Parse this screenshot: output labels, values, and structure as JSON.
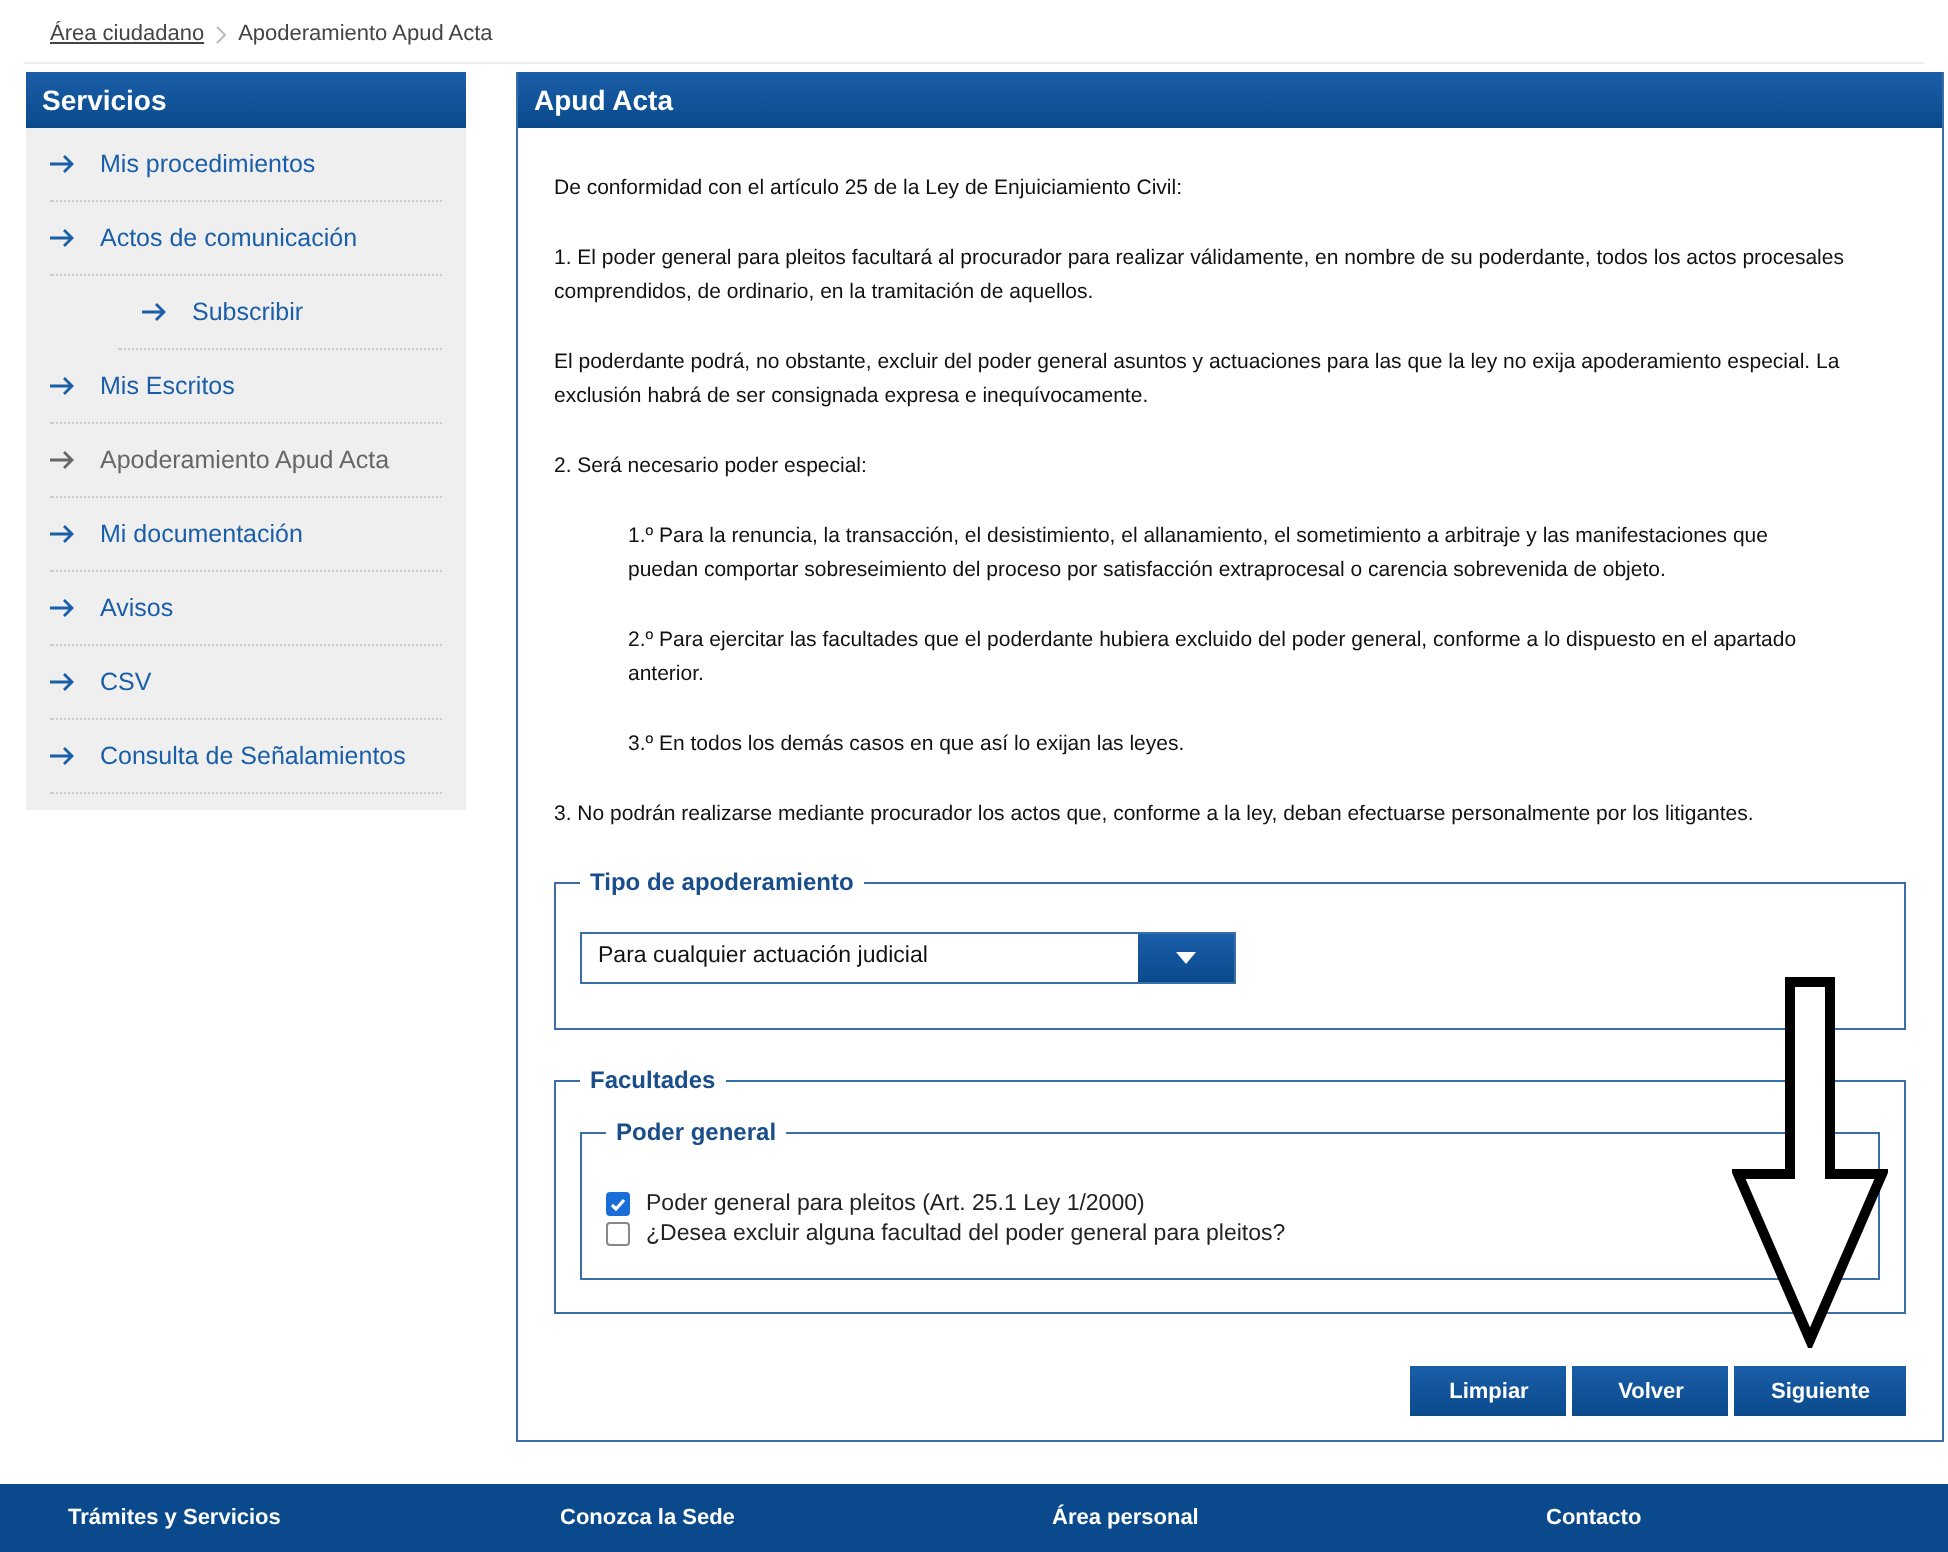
{
  "breadcrumb": [
    {
      "label": "Área ciudadano",
      "link": true
    },
    {
      "label": "Apoderamiento Apud Acta",
      "link": false
    }
  ],
  "sidebar": {
    "title": "Servicios",
    "items": [
      {
        "label": "Mis procedimientos",
        "selected": false
      },
      {
        "label": "Actos de comunicación",
        "selected": false,
        "children": [
          {
            "label": "Subscribir",
            "selected": false
          }
        ]
      },
      {
        "label": "Mis Escritos",
        "selected": false
      },
      {
        "label": "Apoderamiento Apud Acta",
        "selected": true
      },
      {
        "label": "Mi documentación",
        "selected": false
      },
      {
        "label": "Avisos",
        "selected": false
      },
      {
        "label": "CSV",
        "selected": false
      },
      {
        "label": "Consulta de Señalamientos",
        "selected": false
      }
    ]
  },
  "main": {
    "title": "Apud Acta",
    "paragraphs": [
      {
        "text": "De conformidad con el artículo 25 de la Ley de Enjuiciamiento Civil:",
        "indented": false
      },
      {
        "text": "1. El poder general para pleitos facultará al procurador para realizar válidamente, en nombre de su poderdante, todos los actos procesales comprendidos, de ordinario, en la tramitación de aquellos.",
        "indented": false
      },
      {
        "text": "El poderdante podrá, no obstante, excluir del poder general asuntos y actuaciones para las que la ley no exija apoderamiento especial. La exclusión habrá de ser consignada expresa e inequívocamente.",
        "indented": false
      },
      {
        "text": "2. Será necesario poder especial:",
        "indented": false
      },
      {
        "text": "1.º Para la renuncia, la transacción, el desistimiento, el allanamiento, el sometimiento a arbitraje y las manifestaciones que puedan comportar sobreseimiento del proceso por satisfacción extraprocesal o carencia sobrevenida de objeto.",
        "indented": true
      },
      {
        "text": "2.º Para ejercitar las facultades que el poderdante hubiera excluido del poder general, conforme a lo dispuesto en el apartado anterior.",
        "indented": true
      },
      {
        "text": "3.º En todos los demás casos en que así lo exijan las leyes.",
        "indented": true
      },
      {
        "text": "3. No podrán realizarse mediante procurador los actos que, conforme a la ley, deban efectuarse personalmente por los litigantes.",
        "indented": false
      }
    ],
    "tipo": {
      "legend": "Tipo de apoderamiento",
      "value": "Para cualquier actuación judicial"
    },
    "facultades": {
      "legend": "Facultades",
      "group": {
        "legend": "Poder general",
        "options": [
          {
            "label": "Poder general para pleitos (Art. 25.1 Ley 1/2000)",
            "checked": true
          },
          {
            "label": "¿Desea excluir alguna facultad del poder general para pleitos?",
            "checked": false
          }
        ]
      }
    },
    "buttons": [
      "Limpiar",
      "Volver",
      "Siguiente"
    ]
  },
  "footer": [
    "Trámites y Servicios",
    "Conozca la Sede",
    "Área personal",
    "Contacto"
  ]
}
